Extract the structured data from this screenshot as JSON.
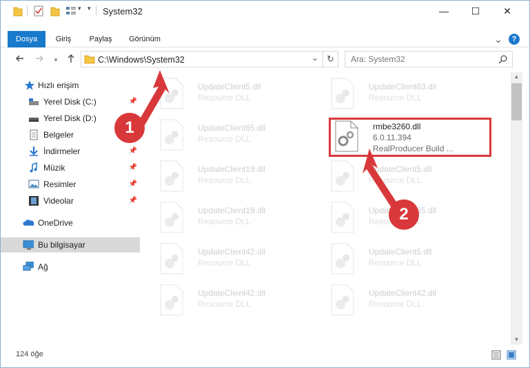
{
  "window": {
    "title": "System32",
    "controls": {
      "minimize": "—",
      "maximize": "☐",
      "close": "✕"
    }
  },
  "ribbon": {
    "tabs": [
      "Dosya",
      "Giriş",
      "Paylaş",
      "Görünüm"
    ],
    "collapse_glyph": "⌄",
    "help_glyph": "?"
  },
  "address": {
    "path": "C:\\Windows\\System32",
    "refresh_glyph": "↻",
    "dropdown_glyph": "⌄"
  },
  "search": {
    "placeholder": "Ara: System32"
  },
  "sidebar": {
    "items": [
      {
        "label": "Hızlı erişim",
        "icon": "star-icon",
        "pinned": false
      },
      {
        "label": "Yerel Disk (C:)",
        "icon": "drive-icon",
        "pinned": true
      },
      {
        "label": "Yerel Disk (D:)",
        "icon": "drive-icon",
        "pinned": true
      },
      {
        "label": "Belgeler",
        "icon": "documents-icon",
        "pinned": true
      },
      {
        "label": "İndirmeler",
        "icon": "downloads-icon",
        "pinned": true
      },
      {
        "label": "Müzik",
        "icon": "music-icon",
        "pinned": true
      },
      {
        "label": "Resimler",
        "icon": "pictures-icon",
        "pinned": true
      },
      {
        "label": "Videolar",
        "icon": "videos-icon",
        "pinned": true
      },
      {
        "label": "OneDrive",
        "icon": "onedrive-icon",
        "pinned": false
      },
      {
        "label": "Bu bilgisayar",
        "icon": "this-pc-icon",
        "pinned": false
      },
      {
        "label": "Ağ",
        "icon": "network-icon",
        "pinned": false
      }
    ]
  },
  "files": {
    "left": [
      {
        "name": "UpdateClient5.dll",
        "desc": "Resource DLL"
      },
      {
        "name": "UpdateClient65.dll",
        "desc": "Resource DLL"
      },
      {
        "name": "UpdateClient19.dll",
        "desc": "Resource DLL"
      },
      {
        "name": "UpdateClient19.dll",
        "desc": "Resource DLL"
      },
      {
        "name": "UpdateClient42.dll",
        "desc": "Resource DLL"
      },
      {
        "name": "UpdateClient42.dll",
        "desc": "Resource DLL"
      }
    ],
    "right": [
      {
        "name": "UpdateClient63.dll",
        "desc": "Resource DLL"
      },
      {
        "name": "UpdateClient5.dll",
        "desc": "Resource DLL"
      },
      {
        "name": "UpdateClient65.dll",
        "desc": "Resource DLL"
      },
      {
        "name": "UpdateClient5.dll",
        "desc": "Resource DLL"
      },
      {
        "name": "UpdateClient42.dll",
        "desc": "Resource DLL"
      }
    ],
    "highlighted": {
      "name": "rmbe3260.dll",
      "version": "6.0.11.394",
      "desc": "RealProducer Build ..."
    }
  },
  "status": {
    "count": "124 öğe"
  },
  "annotations": {
    "step1": "1",
    "step2": "2",
    "color": "#d9383a"
  }
}
